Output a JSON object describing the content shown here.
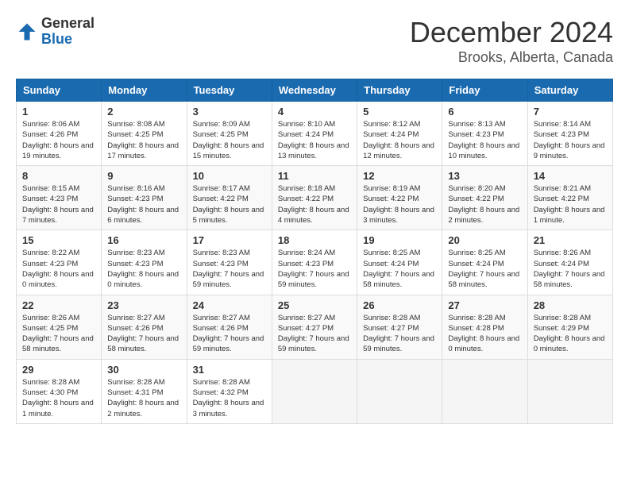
{
  "logo": {
    "general": "General",
    "blue": "Blue"
  },
  "title": "December 2024",
  "subtitle": "Brooks, Alberta, Canada",
  "days_of_week": [
    "Sunday",
    "Monday",
    "Tuesday",
    "Wednesday",
    "Thursday",
    "Friday",
    "Saturday"
  ],
  "weeks": [
    [
      {
        "day": "1",
        "sunrise": "Sunrise: 8:06 AM",
        "sunset": "Sunset: 4:26 PM",
        "daylight": "Daylight: 8 hours and 19 minutes."
      },
      {
        "day": "2",
        "sunrise": "Sunrise: 8:08 AM",
        "sunset": "Sunset: 4:25 PM",
        "daylight": "Daylight: 8 hours and 17 minutes."
      },
      {
        "day": "3",
        "sunrise": "Sunrise: 8:09 AM",
        "sunset": "Sunset: 4:25 PM",
        "daylight": "Daylight: 8 hours and 15 minutes."
      },
      {
        "day": "4",
        "sunrise": "Sunrise: 8:10 AM",
        "sunset": "Sunset: 4:24 PM",
        "daylight": "Daylight: 8 hours and 13 minutes."
      },
      {
        "day": "5",
        "sunrise": "Sunrise: 8:12 AM",
        "sunset": "Sunset: 4:24 PM",
        "daylight": "Daylight: 8 hours and 12 minutes."
      },
      {
        "day": "6",
        "sunrise": "Sunrise: 8:13 AM",
        "sunset": "Sunset: 4:23 PM",
        "daylight": "Daylight: 8 hours and 10 minutes."
      },
      {
        "day": "7",
        "sunrise": "Sunrise: 8:14 AM",
        "sunset": "Sunset: 4:23 PM",
        "daylight": "Daylight: 8 hours and 9 minutes."
      }
    ],
    [
      {
        "day": "8",
        "sunrise": "Sunrise: 8:15 AM",
        "sunset": "Sunset: 4:23 PM",
        "daylight": "Daylight: 8 hours and 7 minutes."
      },
      {
        "day": "9",
        "sunrise": "Sunrise: 8:16 AM",
        "sunset": "Sunset: 4:23 PM",
        "daylight": "Daylight: 8 hours and 6 minutes."
      },
      {
        "day": "10",
        "sunrise": "Sunrise: 8:17 AM",
        "sunset": "Sunset: 4:22 PM",
        "daylight": "Daylight: 8 hours and 5 minutes."
      },
      {
        "day": "11",
        "sunrise": "Sunrise: 8:18 AM",
        "sunset": "Sunset: 4:22 PM",
        "daylight": "Daylight: 8 hours and 4 minutes."
      },
      {
        "day": "12",
        "sunrise": "Sunrise: 8:19 AM",
        "sunset": "Sunset: 4:22 PM",
        "daylight": "Daylight: 8 hours and 3 minutes."
      },
      {
        "day": "13",
        "sunrise": "Sunrise: 8:20 AM",
        "sunset": "Sunset: 4:22 PM",
        "daylight": "Daylight: 8 hours and 2 minutes."
      },
      {
        "day": "14",
        "sunrise": "Sunrise: 8:21 AM",
        "sunset": "Sunset: 4:22 PM",
        "daylight": "Daylight: 8 hours and 1 minute."
      }
    ],
    [
      {
        "day": "15",
        "sunrise": "Sunrise: 8:22 AM",
        "sunset": "Sunset: 4:23 PM",
        "daylight": "Daylight: 8 hours and 0 minutes."
      },
      {
        "day": "16",
        "sunrise": "Sunrise: 8:23 AM",
        "sunset": "Sunset: 4:23 PM",
        "daylight": "Daylight: 8 hours and 0 minutes."
      },
      {
        "day": "17",
        "sunrise": "Sunrise: 8:23 AM",
        "sunset": "Sunset: 4:23 PM",
        "daylight": "Daylight: 7 hours and 59 minutes."
      },
      {
        "day": "18",
        "sunrise": "Sunrise: 8:24 AM",
        "sunset": "Sunset: 4:23 PM",
        "daylight": "Daylight: 7 hours and 59 minutes."
      },
      {
        "day": "19",
        "sunrise": "Sunrise: 8:25 AM",
        "sunset": "Sunset: 4:24 PM",
        "daylight": "Daylight: 7 hours and 58 minutes."
      },
      {
        "day": "20",
        "sunrise": "Sunrise: 8:25 AM",
        "sunset": "Sunset: 4:24 PM",
        "daylight": "Daylight: 7 hours and 58 minutes."
      },
      {
        "day": "21",
        "sunrise": "Sunrise: 8:26 AM",
        "sunset": "Sunset: 4:24 PM",
        "daylight": "Daylight: 7 hours and 58 minutes."
      }
    ],
    [
      {
        "day": "22",
        "sunrise": "Sunrise: 8:26 AM",
        "sunset": "Sunset: 4:25 PM",
        "daylight": "Daylight: 7 hours and 58 minutes."
      },
      {
        "day": "23",
        "sunrise": "Sunrise: 8:27 AM",
        "sunset": "Sunset: 4:26 PM",
        "daylight": "Daylight: 7 hours and 58 minutes."
      },
      {
        "day": "24",
        "sunrise": "Sunrise: 8:27 AM",
        "sunset": "Sunset: 4:26 PM",
        "daylight": "Daylight: 7 hours and 59 minutes."
      },
      {
        "day": "25",
        "sunrise": "Sunrise: 8:27 AM",
        "sunset": "Sunset: 4:27 PM",
        "daylight": "Daylight: 7 hours and 59 minutes."
      },
      {
        "day": "26",
        "sunrise": "Sunrise: 8:28 AM",
        "sunset": "Sunset: 4:27 PM",
        "daylight": "Daylight: 7 hours and 59 minutes."
      },
      {
        "day": "27",
        "sunrise": "Sunrise: 8:28 AM",
        "sunset": "Sunset: 4:28 PM",
        "daylight": "Daylight: 8 hours and 0 minutes."
      },
      {
        "day": "28",
        "sunrise": "Sunrise: 8:28 AM",
        "sunset": "Sunset: 4:29 PM",
        "daylight": "Daylight: 8 hours and 0 minutes."
      }
    ],
    [
      {
        "day": "29",
        "sunrise": "Sunrise: 8:28 AM",
        "sunset": "Sunset: 4:30 PM",
        "daylight": "Daylight: 8 hours and 1 minute."
      },
      {
        "day": "30",
        "sunrise": "Sunrise: 8:28 AM",
        "sunset": "Sunset: 4:31 PM",
        "daylight": "Daylight: 8 hours and 2 minutes."
      },
      {
        "day": "31",
        "sunrise": "Sunrise: 8:28 AM",
        "sunset": "Sunset: 4:32 PM",
        "daylight": "Daylight: 8 hours and 3 minutes."
      },
      null,
      null,
      null,
      null
    ]
  ]
}
